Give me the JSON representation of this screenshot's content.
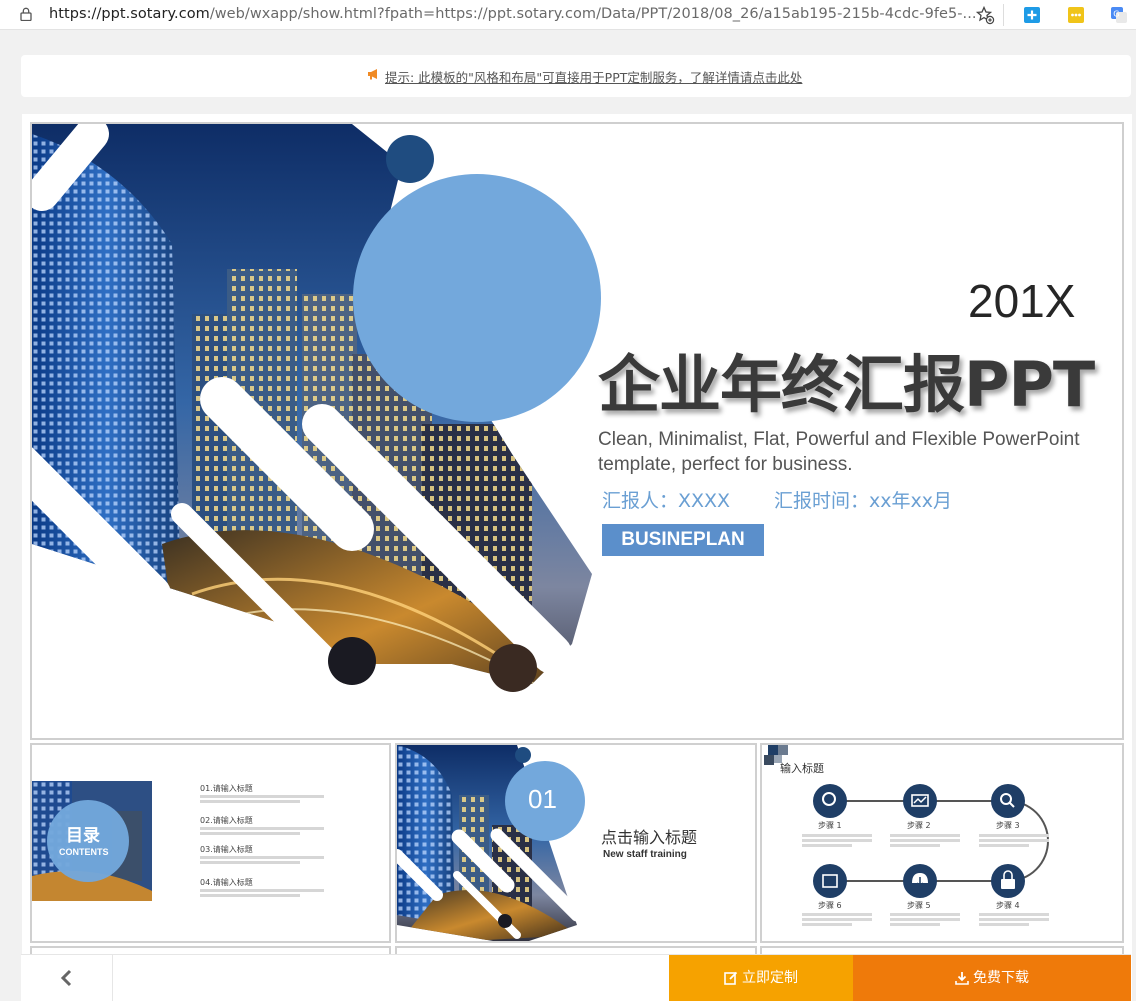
{
  "browser": {
    "url_host": "https://ppt.sotary.com",
    "url_path": "/web/wxapp/show.html?fpath=https://ppt.sotary.com/Data/PPT/2018/08_26/a15ab195-215b-4cdc-9fe5-..."
  },
  "notice": {
    "text": "提示: 此模板的\"风格和布局\"可直接用于PPT定制服务，了解详情请点击此处"
  },
  "slide": {
    "year": "201X",
    "title": "企业年终汇报PPT",
    "description": "Clean, Minimalist, Flat, Powerful and Flexible PowerPoint template, perfect for business.",
    "reporter": "汇报人：XXXX",
    "report_time": "汇报时间：xx年xx月",
    "button": "BUSINEPLAN"
  },
  "thumb1": {
    "circle_title": "目录",
    "circle_sub": "CONTENTS",
    "items": [
      "01.请输入标题",
      "02.请输入标题",
      "03.请输入标题",
      "04.请输入标题"
    ]
  },
  "thumb2": {
    "number": "01",
    "title": "点击输入标题",
    "subtitle": "New staff training"
  },
  "thumb3": {
    "title": "输入标题",
    "steps": [
      "步骤 1",
      "步骤 2",
      "步骤 3",
      "步骤 6",
      "步骤 5",
      "步骤 4"
    ]
  },
  "actions": {
    "customize": "立即定制",
    "download": "免费下载"
  },
  "colors": {
    "accent_blue": "#5b8fcb",
    "customize_orange": "#f6a200",
    "download_orange": "#ef7a0a"
  }
}
